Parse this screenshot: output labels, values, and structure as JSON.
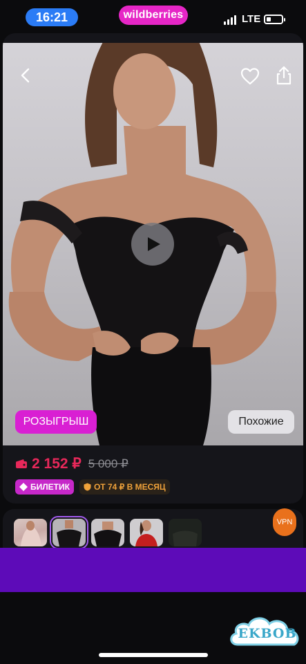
{
  "status_bar": {
    "time": "16:21",
    "brand": "wildberries",
    "network": "LTE",
    "brand_color": "#e626c6",
    "time_pill_color": "#2b7cf6"
  },
  "product": {
    "promo_label": "РОЗЫГРЫШ",
    "similar_label": "Похожие",
    "price": "2 152 ₽",
    "old_price": "5 000 ₽",
    "ticket_label": "БИЛЕТИК",
    "installment_label": "ОТ 74 ₽ В МЕСЯЦ",
    "price_color": "#e8285a",
    "accent_color": "#d91fd3"
  },
  "icons": {
    "back": "chevron-left-icon",
    "favorite": "heart-icon",
    "share": "share-icon",
    "play": "play-icon",
    "wallet": "wallet-icon",
    "ticket": "ticket-icon",
    "installment": "shield-icon"
  },
  "thumbnails": [
    {
      "name": "thumb-1",
      "selected": false
    },
    {
      "name": "thumb-2",
      "selected": true
    },
    {
      "name": "thumb-3",
      "selected": false
    },
    {
      "name": "thumb-4",
      "selected": false
    },
    {
      "name": "thumb-5",
      "selected": false
    }
  ],
  "vpn_badge": "VPN",
  "watermark": "EKBOB",
  "band_color": "#5d0bb8"
}
